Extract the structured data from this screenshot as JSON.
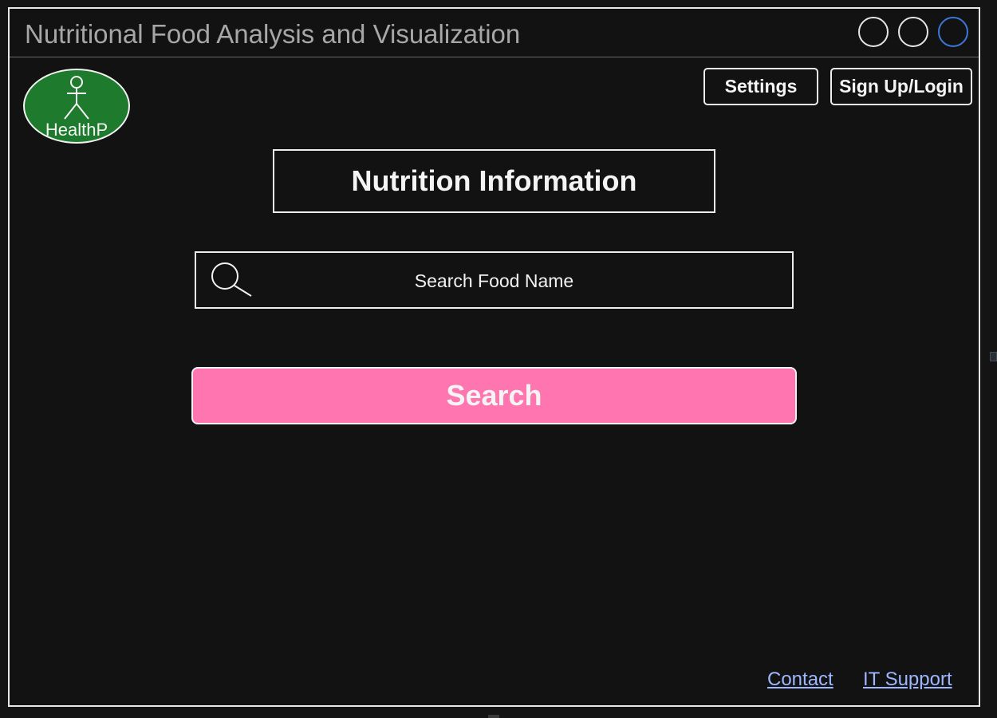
{
  "window": {
    "title": "Nutritional Food Analysis and Visualization",
    "controls": [
      "window-control",
      "window-control",
      "window-control-active"
    ],
    "accent_color": "#3b78d8"
  },
  "logo": {
    "label": "HealthP",
    "icon": "person-icon",
    "background_color": "#1e7a2d"
  },
  "header": {
    "settings_label": "Settings",
    "login_label": "Sign Up/Login"
  },
  "main": {
    "title": "Nutrition Information",
    "search": {
      "placeholder": "Search Food Name",
      "icon": "search-icon"
    },
    "search_button": {
      "label": "Search",
      "color": "#ff75b0"
    }
  },
  "footer": {
    "contact_label": "Contact",
    "support_label": "IT Support",
    "link_color": "#9fb7ff"
  }
}
